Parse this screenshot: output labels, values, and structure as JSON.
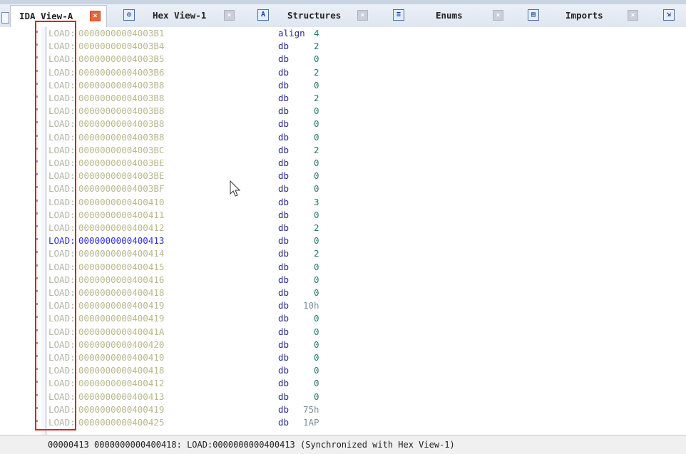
{
  "tabs": [
    {
      "label": "IDA View-A",
      "active": true,
      "icon": ""
    },
    {
      "label": "Hex View-1",
      "active": false,
      "icon": "hex-icon"
    },
    {
      "label": "Structures",
      "active": false,
      "icon": "A"
    },
    {
      "label": "Enums",
      "active": false,
      "icon": "enum-icon"
    },
    {
      "label": "Imports",
      "active": false,
      "icon": "imports-icon"
    }
  ],
  "close_glyph": "×",
  "listing": {
    "rows": [
      {
        "seg": "LOAD:",
        "addr": "00000000004003B1",
        "mn": "align",
        "op": "4",
        "sel": false
      },
      {
        "seg": "LOAD:",
        "addr": "00000000004003B4",
        "mn": "db",
        "op": "2",
        "sel": false
      },
      {
        "seg": "LOAD:",
        "addr": "00000000004003B5",
        "mn": "db",
        "op": "0",
        "sel": false
      },
      {
        "seg": "LOAD:",
        "addr": "00000000004003B6",
        "mn": "db",
        "op": "2",
        "sel": false
      },
      {
        "seg": "LOAD:",
        "addr": "00000000004003B8",
        "mn": "db",
        "op": "0",
        "sel": false
      },
      {
        "seg": "LOAD:",
        "addr": "00000000004003B8",
        "mn": "db",
        "op": "2",
        "sel": false
      },
      {
        "seg": "LOAD:",
        "addr": "00000000004003B8",
        "mn": "db",
        "op": "0",
        "sel": false
      },
      {
        "seg": "LOAD:",
        "addr": "00000000004003B8",
        "mn": "db",
        "op": "0",
        "sel": false
      },
      {
        "seg": "LOAD:",
        "addr": "00000000004003B8",
        "mn": "db",
        "op": "0",
        "sel": false
      },
      {
        "seg": "LOAD:",
        "addr": "00000000004003BC",
        "mn": "db",
        "op": "2",
        "sel": false
      },
      {
        "seg": "LOAD:",
        "addr": "00000000004003BE",
        "mn": "db",
        "op": "0",
        "sel": false
      },
      {
        "seg": "LOAD:",
        "addr": "00000000004003BE",
        "mn": "db",
        "op": "0",
        "sel": false
      },
      {
        "seg": "LOAD:",
        "addr": "00000000004003BF",
        "mn": "db",
        "op": "0",
        "sel": false
      },
      {
        "seg": "LOAD:",
        "addr": "0000000000400410",
        "mn": "db",
        "op": "3",
        "sel": false
      },
      {
        "seg": "LOAD:",
        "addr": "0000000000400411",
        "mn": "db",
        "op": "0",
        "sel": false
      },
      {
        "seg": "LOAD:",
        "addr": "0000000000400412",
        "mn": "db",
        "op": "2",
        "sel": false
      },
      {
        "seg": "LOAD:",
        "addr": "0000000000400413",
        "mn": "db",
        "op": "0",
        "sel": true
      },
      {
        "seg": "LOAD:",
        "addr": "0000000000400414",
        "mn": "db",
        "op": "2",
        "sel": false
      },
      {
        "seg": "LOAD:",
        "addr": "0000000000400415",
        "mn": "db",
        "op": "0",
        "sel": false
      },
      {
        "seg": "LOAD:",
        "addr": "0000000000400416",
        "mn": "db",
        "op": "0",
        "sel": false
      },
      {
        "seg": "LOAD:",
        "addr": "0000000000400418",
        "mn": "db",
        "op": "0",
        "sel": false
      },
      {
        "seg": "LOAD:",
        "addr": "0000000000400419",
        "mn": "db",
        "op": "10h",
        "sel": false
      },
      {
        "seg": "LOAD:",
        "addr": "0000000000400419",
        "mn": "db",
        "op": "0",
        "sel": false
      },
      {
        "seg": "LOAD:",
        "addr": "000000000040041A",
        "mn": "db",
        "op": "0",
        "sel": false
      },
      {
        "seg": "LOAD:",
        "addr": "0000000000400420",
        "mn": "db",
        "op": "0",
        "sel": false
      },
      {
        "seg": "LOAD:",
        "addr": "0000000000400410",
        "mn": "db",
        "op": "0",
        "sel": false
      },
      {
        "seg": "LOAD:",
        "addr": "0000000000400418",
        "mn": "db",
        "op": "0",
        "sel": false
      },
      {
        "seg": "LOAD:",
        "addr": "0000000000400412",
        "mn": "db",
        "op": "0",
        "sel": false
      },
      {
        "seg": "LOAD:",
        "addr": "0000000000400413",
        "mn": "db",
        "op": "0",
        "sel": false
      },
      {
        "seg": "LOAD:",
        "addr": "0000000000400419",
        "mn": "db",
        "op": "75h",
        "sel": false
      },
      {
        "seg": "LOAD:",
        "addr": "0000000000400425",
        "mn": "db",
        "op": "1AP",
        "sel": false
      }
    ]
  },
  "status": {
    "text": "00000413 0000000000400418: LOAD:0000000000400413 (Synchronized with Hex View-1)"
  },
  "colors": {
    "highlight": "#2d2df0",
    "address_faded": "#b9b88e",
    "mnemonic": "#2b2b8c",
    "operand": "#2a7a6a",
    "annotation_box": "#e02020"
  }
}
